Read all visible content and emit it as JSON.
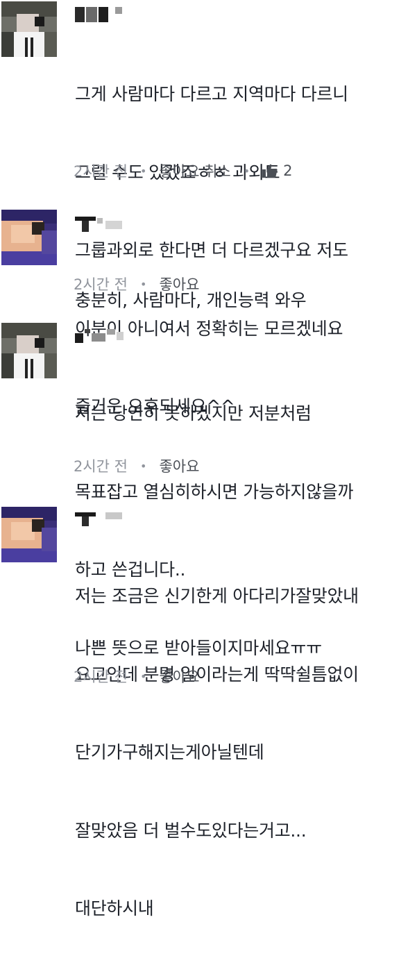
{
  "comments": [
    {
      "lines": [
        "그게 사람마다 다르고 지역마다 다르니",
        "그럴 수도 있겠죠ㅎㅎ 과외도",
        "그룹과외로 한다면 더 다르겠구요 저도",
        "이분이 아니여서 정확히는 모르겠네요",
        "즐거운 오후되세요^^"
      ],
      "time": "2시간 전",
      "like_label": "좋아요 취소",
      "reaction_count": "2",
      "reaction_icon": "thumbs-up-icon"
    },
    {
      "lines": [
        "충분히, 사람마다, 개인능력 와우"
      ],
      "time": "2시간 전",
      "like_label": "좋아요"
    },
    {
      "lines": [
        "저는 당연히 못하겠지만 저분처럼",
        "목표잡고 열심히하시면 가능하지않을까",
        "하고 쓴겁니다..",
        "나쁜 뜻으로 받아들이지마세요ㅠㅠ"
      ],
      "time": "2시간 전",
      "like_label": "좋아요"
    },
    {
      "lines": [
        "저는 조금은 신기한게 아다리가잘맞았내",
        "요고인데 분명 일이라는게 딱딱쉴틈없이",
        "단기가구해지는게아닐텐데",
        "잘맞았음 더 벌수도있다는거고...",
        "대단하시내"
      ],
      "time": "2시간 전",
      "like_label": "좋아요"
    }
  ],
  "colors": {
    "text": "#1d2129",
    "meta": "#90949c",
    "link": "#4b4f56"
  }
}
